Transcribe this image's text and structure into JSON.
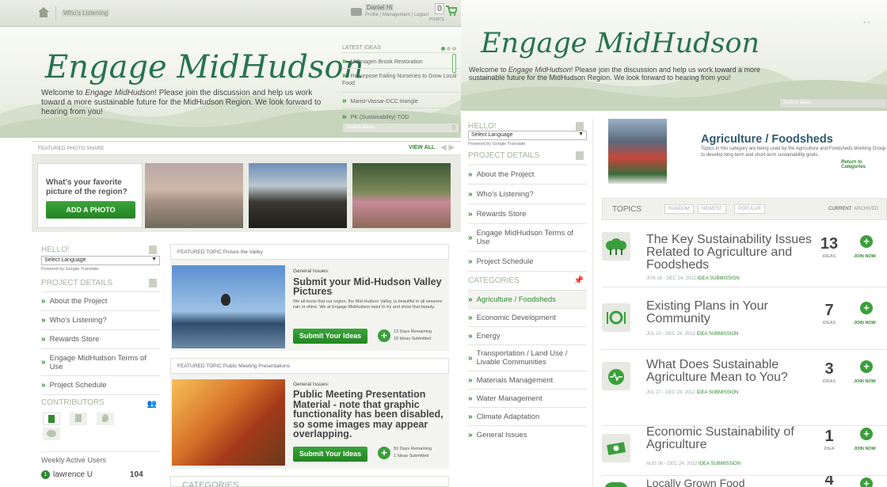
{
  "left": {
    "topbar": {
      "home_icon": "home-icon",
      "who_label": "Who's Listening",
      "user_name": "Daniel Hi",
      "user_links": "Profile | Management | Logout",
      "points": "0",
      "points_label": "POINTS",
      "cart_icon": "cart-icon"
    },
    "site_title": "Engage MidHudson",
    "welcome_pre": "Welcome to ",
    "welcome_em": "Engage MidHudson",
    "welcome_post": "! Please join the discussion and help us work toward a more sustainable future for the MidHudson Region. We look forward to hearing from you!",
    "latest": {
      "title": "LATEST IDEAS",
      "items": [
        "Mohnagen Brook Restoration",
        "Repurpose Failing Nurseries to Grow Local Food",
        "Marist-Vassar-DCC triangle",
        "PK (Sustainability) TOD"
      ],
      "search_placeholder": "Search Ideas"
    },
    "photo_share": {
      "title": "FEATURED PHOTO SHARE",
      "view_all": "VIEW ALL",
      "question": "What's your favorite picture of the region?",
      "button": "ADD A PHOTO"
    },
    "sidebar": {
      "hello": "HELLO!",
      "language": "Select Language",
      "powered": "Powered by Google Translate",
      "project_details": "PROJECT DETAILS",
      "nav": [
        "About the Project",
        "Who's Listening?",
        "Rewards Store",
        "Engage MidHudson Terms of Use",
        "Project Schedule"
      ],
      "contributors": "CONTRIBUTORS",
      "weekly": "Weekly Active Users",
      "leader_rank": "1",
      "leader_name": "lawrence U",
      "leader_points": "104"
    },
    "topic1": {
      "header": "FEATURED TOPIC Picture the Valley",
      "category": "General Issues:",
      "title": "Submit your Mid-Hudson Valley Pictures",
      "desc": "We all know that our region, the Mid-Hudson Valley, is beautiful in all seasons rain or shine. We at Engage MidHudson want to try and show that beauty.",
      "button": "Submit Your Ideas",
      "days": "13 Days Remaining",
      "ideas": "18 Ideas Submitted"
    },
    "topic2": {
      "header": "FEATURED TOPIC Public Meeting Presentations",
      "category": "General Issues:",
      "title": "Public Meeting Presentation Material - note that graphic functionality has been disabled, so some images may appear overlapping.",
      "button": "Submit Your Ideas",
      "days": "50 Days Remaining",
      "ideas": "1 Ideas Submitted"
    },
    "categories_partial": "CATEGORIES"
  },
  "right": {
    "site_title": "Engage MidHudson",
    "welcome_pre": "Welcome to ",
    "welcome_em": "Engage MidHudson",
    "welcome_post": "! Please join the discussion and help us work toward a more sustainable future for the MidHudson Region. We look forward to hearing from you!",
    "search_placeholder": "Search Ideas",
    "sidebar": {
      "hello": "HELLO!",
      "language": "Select Language",
      "powered": "Powered by Google Translate",
      "project_details": "PROJECT DETAILS",
      "nav": [
        "About the Project",
        "Who's Listening?",
        "Rewards Store",
        "Engage MidHudson Terms of Use",
        "Project Schedule"
      ],
      "categories": "CATEGORIES",
      "cats": [
        "Agriculture / Foodsheds",
        "Economic Development",
        "Energy",
        "Transportation / Land Use / Livable Communities",
        "Materials Management",
        "Water Management",
        "Climate Adaptation",
        "General Issues"
      ]
    },
    "category": {
      "title": "Agriculture / Foodsheds",
      "desc": "Topics in this category are being used by the Agriculture and Foodsheds Working Group to develop long-term and short-term sustainability goals.",
      "return": "Return to Categories"
    },
    "topics_bar": {
      "label": "TOPICS",
      "random": "RANDOM",
      "newest": "NEWEST",
      "popular": "POPULAR",
      "current": "CURRENT",
      "archived": "ARCHIVED"
    },
    "topics": [
      {
        "title": "The Key Sustainability Issues Related to Agriculture and Foodsheds",
        "date": "JUN 18 - DEC 24, 2012",
        "tag": "IDEA SUBMISSION",
        "count": "13",
        "label": "IDEAS",
        "join": "JOIN NOW"
      },
      {
        "title": "Existing Plans in Your Community",
        "date": "JUL 10 - DEC 24, 2012",
        "tag": "IDEA SUBMISSION",
        "count": "7",
        "label": "IDEAS",
        "join": "JOIN NOW"
      },
      {
        "title": "What Does Sustainable Agriculture Mean to You?",
        "date": "JUL 27 - DEC 24, 2012",
        "tag": "IDEA SUBMISSION",
        "count": "3",
        "label": "IDEAS",
        "join": "JOIN NOW"
      },
      {
        "title": "Economic Sustainability of Agriculture",
        "date": "AUG 06 - DEC 24, 2012",
        "tag": "IDEA SUBMISSION",
        "count": "1",
        "label": "IDEA",
        "join": "JOIN NOW"
      },
      {
        "title": "Locally Grown Food",
        "count": "4"
      }
    ]
  }
}
